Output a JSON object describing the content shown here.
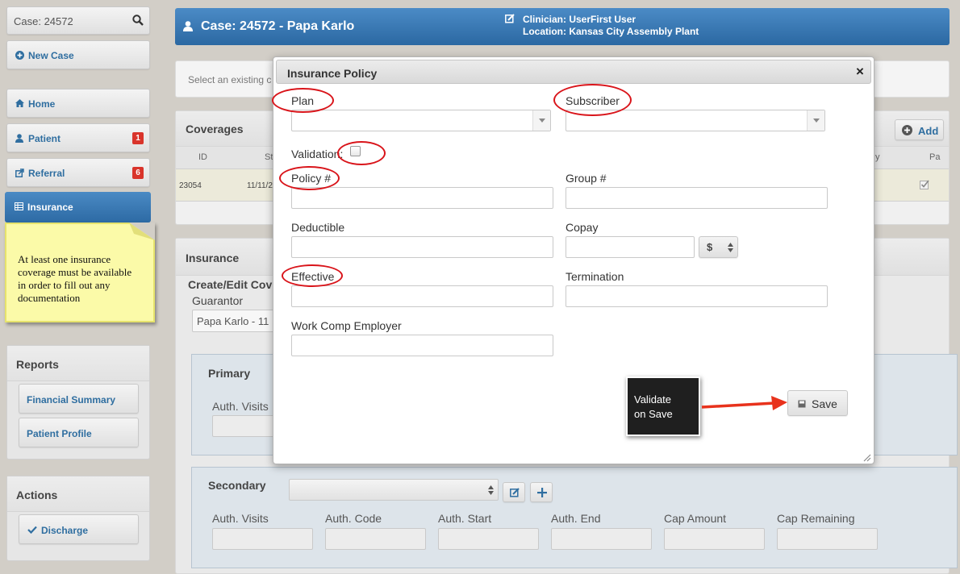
{
  "sidebar": {
    "case_search": "Case: 24572",
    "new_case": "New Case",
    "nav": {
      "home": "Home",
      "patient": "Patient",
      "patient_badge": "1",
      "referral": "Referral",
      "referral_badge": "6",
      "insurance": "Insurance"
    },
    "reports_title": "Reports",
    "reports": {
      "financial_summary": "Financial Summary",
      "patient_profile": "Patient Profile"
    },
    "actions_title": "Actions",
    "discharge": "Discharge"
  },
  "sticky_note": "At least one insurance coverage must be available in order to fill out any documentation",
  "header": {
    "case_title": "Case: 24572 - Papa Karlo",
    "clinician": "Clinician: UserFirst User",
    "location": "Location: Kansas City Assembly Plant"
  },
  "main": {
    "select_hint": "Select an existing c",
    "coverages_title": "Coverages",
    "add_button": "Add",
    "table_headers": {
      "id": "ID",
      "st": "St",
      "y": "y",
      "pa": "Pa"
    },
    "row": {
      "id": "23054",
      "date": "11/11/2"
    },
    "insurance_title": "Insurance",
    "create_edit": "Create/Edit Cov",
    "guarantor_label": "Guarantor",
    "guarantor_value": "Papa Karlo - 11",
    "primary_title": "Primary",
    "primary_auth_visits": "Auth. Visits",
    "secondary_title": "Secondary",
    "currency": "$",
    "secondary_fields": {
      "auth_visits": "Auth. Visits",
      "auth_code": "Auth. Code",
      "auth_start": "Auth. Start",
      "auth_end": "Auth. End",
      "cap_amount": "Cap Amount",
      "cap_remaining": "Cap Remaining"
    }
  },
  "modal": {
    "title": "Insurance Policy",
    "close": "×",
    "plan": "Plan",
    "subscriber": "Subscriber",
    "validation": "Validation:",
    "policy": "Policy #",
    "group": "Group #",
    "deductible": "Deductible",
    "copay": "Copay",
    "effective": "Effective",
    "termination": "Termination",
    "work_comp": "Work Comp Employer",
    "save": "Save"
  },
  "callout": {
    "line1": "Validate",
    "line2": "on Save"
  }
}
